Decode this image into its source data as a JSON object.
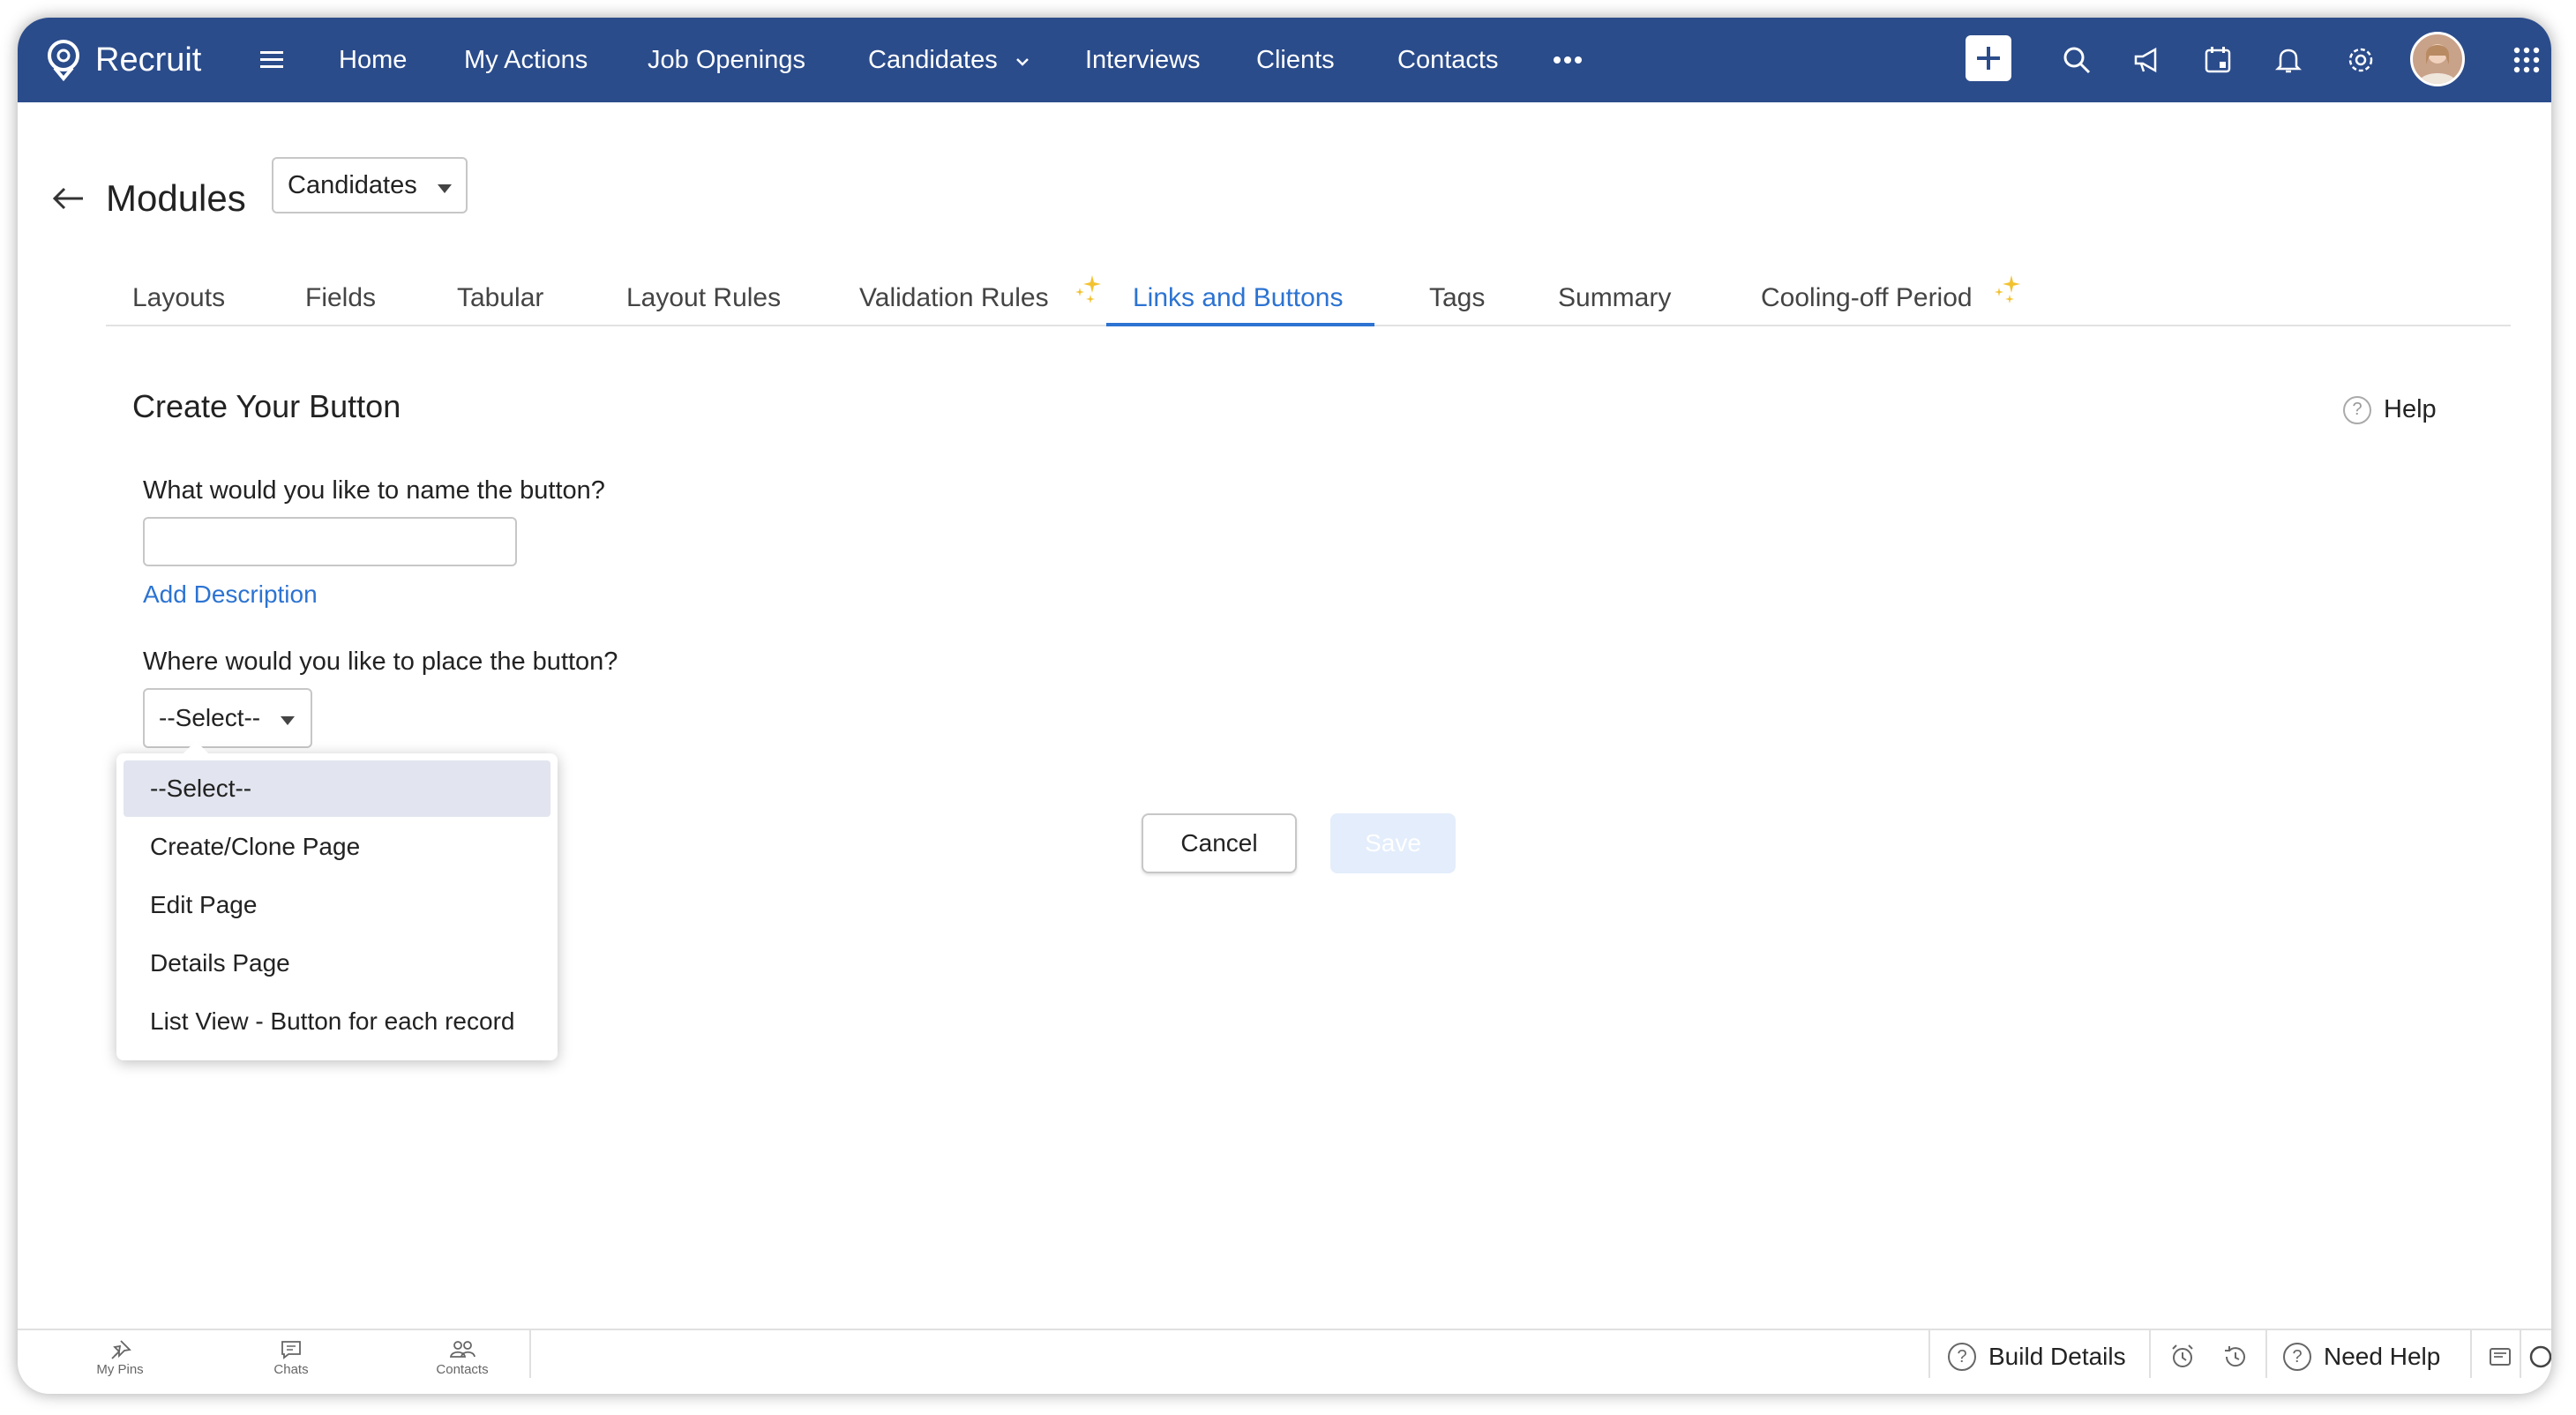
{
  "app": {
    "name": "Recruit"
  },
  "nav": {
    "items": [
      "Home",
      "My Actions",
      "Job Openings",
      "Candidates",
      "Interviews",
      "Clients",
      "Contacts"
    ]
  },
  "header": {
    "title": "Modules",
    "module_selected": "Candidates"
  },
  "tabs": [
    "Layouts",
    "Fields",
    "Tabular",
    "Layout Rules",
    "Validation Rules",
    "Links and Buttons",
    "Tags",
    "Summary",
    "Cooling-off Period"
  ],
  "active_tab": "Links and Buttons",
  "form": {
    "title": "Create Your Button",
    "help_label": "Help",
    "name_question": "What would you like to name the button?",
    "name_value": "",
    "add_description": "Add Description",
    "place_question": "Where would you like to place the button?",
    "place_selected": "--Select--",
    "place_options": [
      "--Select--",
      "Create/Clone Page",
      "Edit Page",
      "Details Page",
      "List View - Button for each record"
    ],
    "cancel_label": "Cancel",
    "save_label": "Save"
  },
  "bottombar": {
    "my_pins": "My Pins",
    "chats": "Chats",
    "contacts": "Contacts",
    "build_details": "Build Details",
    "need_help": "Need Help"
  },
  "colors": {
    "nav_bg": "#2b4c8b",
    "accent": "#2c73d2",
    "sparkle": "#f2c230"
  }
}
